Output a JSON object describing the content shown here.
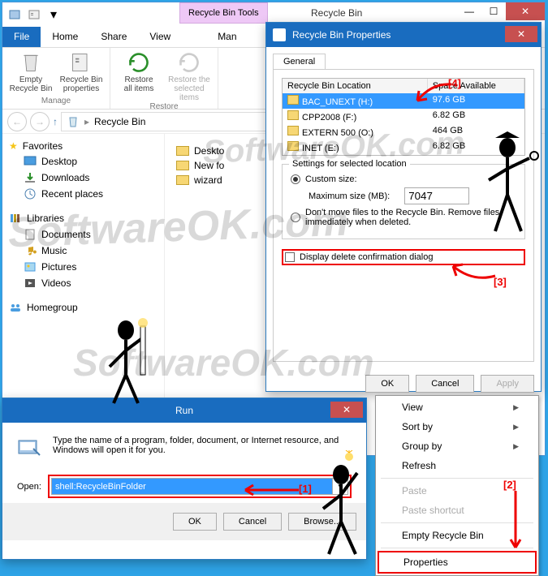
{
  "explorer": {
    "tool_tab": "Recycle Bin Tools",
    "title": "Recycle Bin",
    "file_tab": "File",
    "tabs": [
      "Home",
      "Share",
      "View"
    ],
    "tab_manage": "Man",
    "ribbon": {
      "empty": "Empty\nRecycle Bin",
      "props": "Recycle Bin\nproperties",
      "restore_all": "Restore\nall items",
      "restore_sel": "Restore the\nselected items",
      "grp_manage": "Manage",
      "grp_restore": "Restore"
    },
    "crumb": "Recycle Bin",
    "nav": {
      "favorites": "Favorites",
      "fav_items": [
        "Desktop",
        "Downloads",
        "Recent places"
      ],
      "libraries": "Libraries",
      "lib_items": [
        "Documents",
        "Music",
        "Pictures",
        "Videos"
      ],
      "homegroup": "Homegroup"
    },
    "files": [
      "Deskto",
      "New fo",
      "wizard"
    ]
  },
  "props": {
    "title": "Recycle Bin Properties",
    "tab": "General",
    "col_loc": "Recycle Bin Location",
    "col_space": "Space Available",
    "rows": [
      {
        "name": "BAC_UNEXT (H:)",
        "space": "97.6 GB"
      },
      {
        "name": "CPP2008 (F:)",
        "space": "6.82 GB"
      },
      {
        "name": "EXTERN 500 (O:)",
        "space": "464 GB"
      },
      {
        "name": "INET (E:)",
        "space": "6.82 GB"
      }
    ],
    "settings_title": "Settings for selected location",
    "custom": "Custom size:",
    "maxsize": "Maximum size (MB):",
    "maxsize_val": "7047",
    "noremove": "Don't move files to the Recycle Bin. Remove files immediately when deleted.",
    "confirm": "Display delete confirmation dialog",
    "ok": "OK",
    "cancel": "Cancel",
    "apply": "Apply"
  },
  "ctx": {
    "view": "View",
    "sort": "Sort by",
    "group": "Group by",
    "refresh": "Refresh",
    "paste": "Paste",
    "paste_sc": "Paste shortcut",
    "empty": "Empty Recycle Bin",
    "props": "Properties"
  },
  "run": {
    "title": "Run",
    "desc": "Type the name of a program, folder, document, or Internet resource, and Windows will open it for you.",
    "open_label": "Open:",
    "value": "shell:RecycleBinFolder",
    "ok": "OK",
    "cancel": "Cancel",
    "browse": "Browse..."
  },
  "callouts": {
    "c1": "[1]",
    "c2": "[2]",
    "c3": "[3]",
    "c4": "[4]"
  },
  "watermark": "SoftwareOK.com"
}
